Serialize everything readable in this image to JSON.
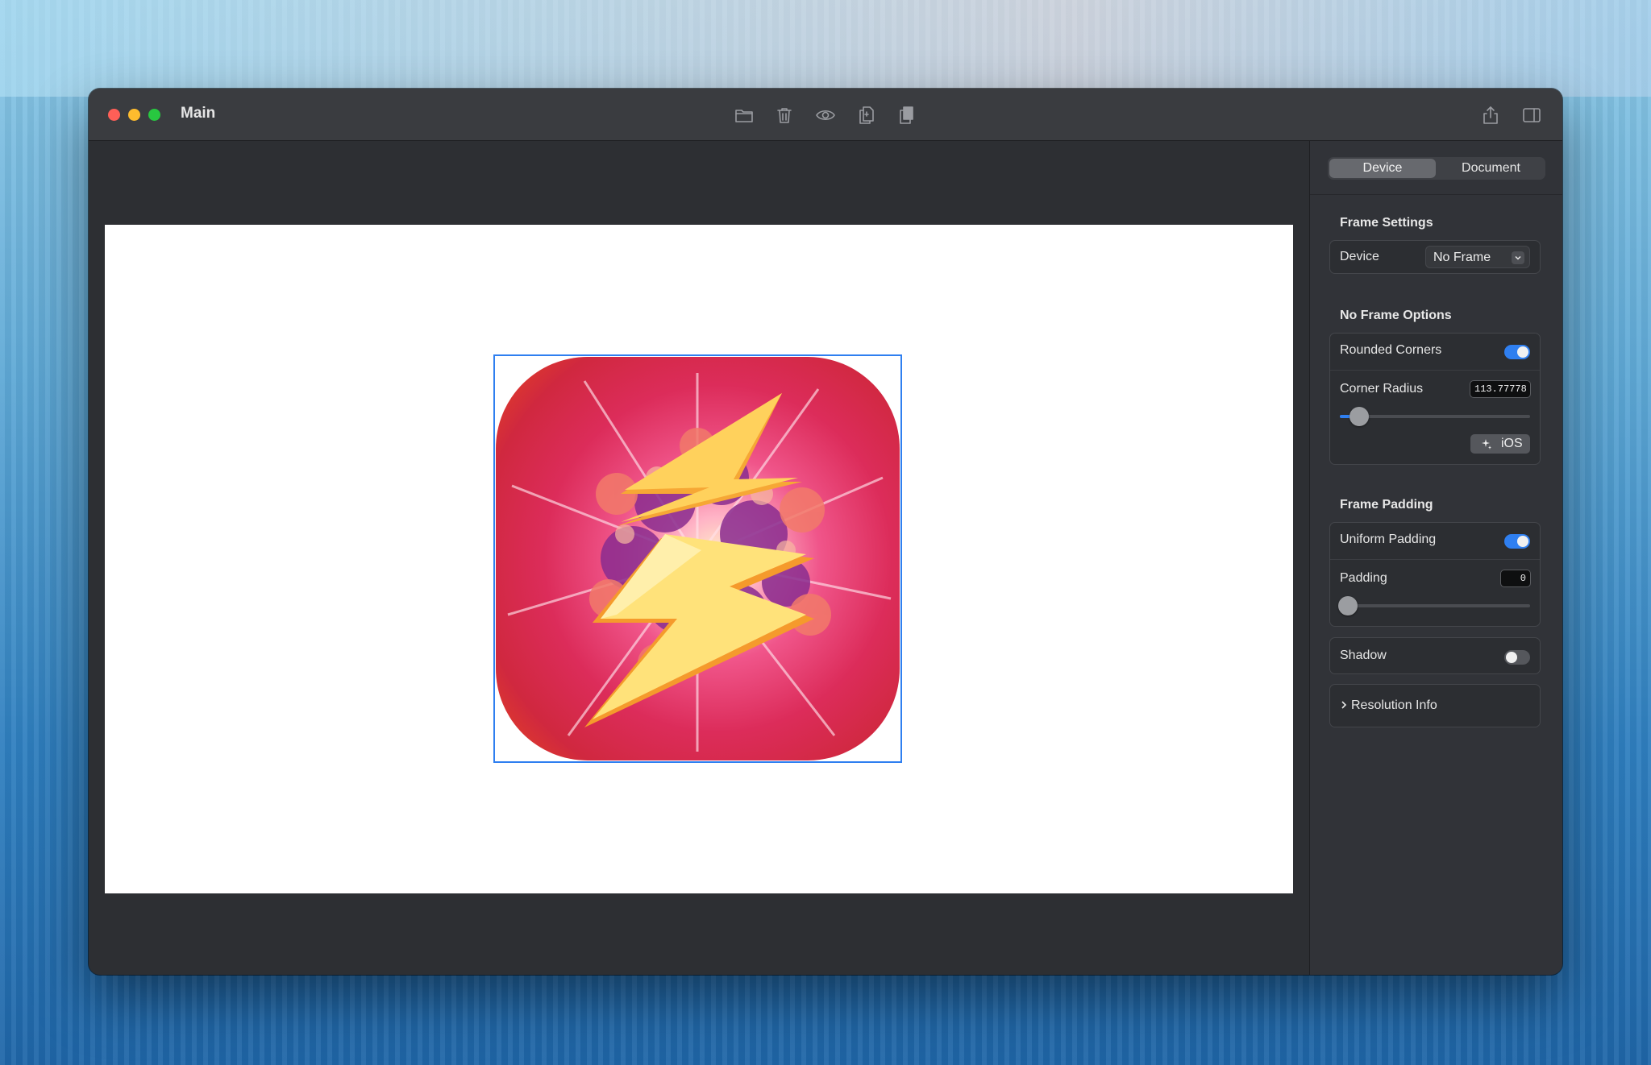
{
  "window": {
    "title": "Main"
  },
  "toolbar": {
    "icons": [
      "folder-icon",
      "trash-icon",
      "eye-icon",
      "copy-icon",
      "paste-icon",
      "share-icon",
      "sidebar-toggle-icon"
    ]
  },
  "sidebar": {
    "segments": {
      "active": "Device",
      "other": "Document"
    },
    "frame_settings": {
      "title": "Frame Settings",
      "device_label": "Device",
      "device_value": "No Frame"
    },
    "no_frame_options": {
      "title": "No Frame Options",
      "rounded_corners_label": "Rounded Corners",
      "rounded_corners_on": true,
      "corner_radius_label": "Corner Radius",
      "corner_radius_value": "113.77778",
      "corner_radius_slider_fraction": 0.1,
      "preset_button": "iOS"
    },
    "frame_padding": {
      "title": "Frame Padding",
      "uniform_label": "Uniform Padding",
      "uniform_on": true,
      "padding_label": "Padding",
      "padding_value": "0",
      "padding_slider_fraction": 0
    },
    "shadow": {
      "label": "Shadow",
      "on": false
    },
    "resolution": {
      "label": "Resolution Info"
    }
  },
  "colors": {
    "accent": "#2f7ff0",
    "window_bg": "#2d2f33",
    "sidebar_bg": "#313338",
    "titlebar_bg": "#3a3c40"
  }
}
